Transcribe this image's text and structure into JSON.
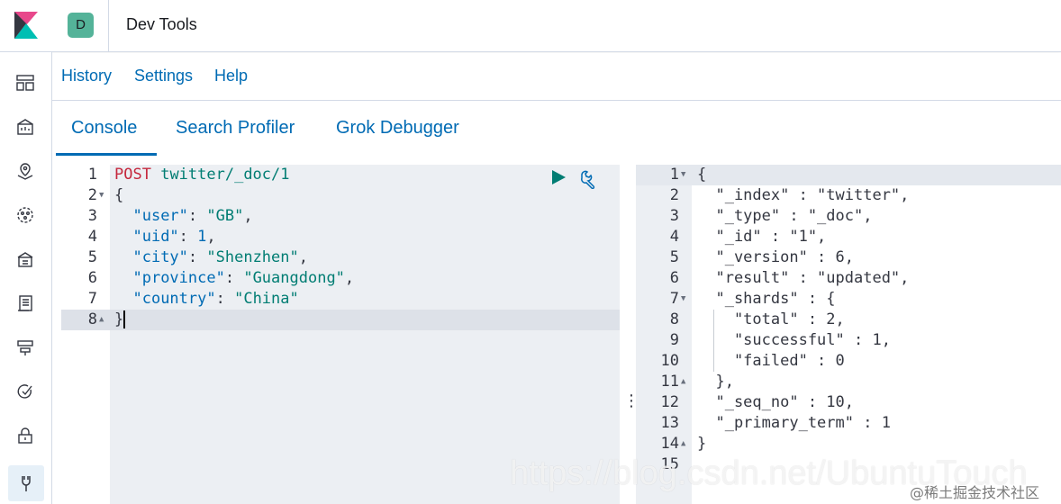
{
  "header": {
    "space_initial": "D",
    "title": "Dev Tools"
  },
  "menu": [
    "History",
    "Settings",
    "Help"
  ],
  "tabs": [
    "Console",
    "Search Profiler",
    "Grok Debugger"
  ],
  "active_tab": "Console",
  "sidebar_icons": [
    "dashboard-icon",
    "canvas-icon",
    "maps-icon",
    "ml-icon",
    "infrastructure-icon",
    "logs-icon",
    "apm-icon",
    "uptime-icon",
    "siem-icon",
    "dev-tools-icon"
  ],
  "request": {
    "line_numbers": [
      "1",
      "2",
      "3",
      "4",
      "5",
      "6",
      "7",
      "8"
    ],
    "method": "POST",
    "url": "twitter/_doc/1",
    "body": [
      {
        "text": "{"
      },
      {
        "key": "\"user\"",
        "value": "\"GB\"",
        "kind": "str",
        "trail": ","
      },
      {
        "key": "\"uid\"",
        "value": "1",
        "kind": "num",
        "trail": ","
      },
      {
        "key": "\"city\"",
        "value": "\"Shenzhen\"",
        "kind": "str",
        "trail": ","
      },
      {
        "key": "\"province\"",
        "value": "\"Guangdong\"",
        "kind": "str",
        "trail": ","
      },
      {
        "key": "\"country\"",
        "value": "\"China\"",
        "kind": "str",
        "trail": ""
      },
      {
        "text": "}"
      }
    ]
  },
  "response": {
    "line_numbers": [
      "1",
      "2",
      "3",
      "4",
      "5",
      "6",
      "7",
      "8",
      "9",
      "10",
      "11",
      "12",
      "13",
      "14",
      "15"
    ],
    "lines": [
      "{",
      "  \"_index\" : \"twitter\",",
      "  \"_type\" : \"_doc\",",
      "  \"_id\" : \"1\",",
      "  \"_version\" : 6,",
      "  \"result\" : \"updated\",",
      "  \"_shards\" : {",
      "    \"total\" : 2,",
      "    \"successful\" : 1,",
      "    \"failed\" : 0",
      "  },",
      "  \"_seq_no\" : 10,",
      "  \"_primary_term\" : 1",
      "}",
      ""
    ]
  },
  "watermark": "https://blog.csdn.net/UbuntuTouch",
  "watermark_cn": "@稀土掘金技术社区",
  "colors": {
    "accent": "#006bb4",
    "method": "#c5283d",
    "string": "#017d73",
    "avatar": "#54b399"
  }
}
